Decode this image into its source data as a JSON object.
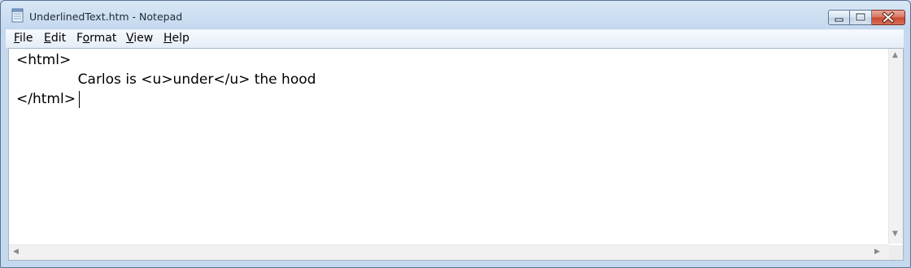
{
  "window": {
    "title": "UnderlinedText.htm - Notepad"
  },
  "menu": [
    {
      "label": "File",
      "accel": "F",
      "rest": "ile"
    },
    {
      "label": "Edit",
      "accel": "E",
      "rest": "dit"
    },
    {
      "label": "Format",
      "pre": "F",
      "accel": "o",
      "rest": "rmat"
    },
    {
      "label": "View",
      "accel": "V",
      "rest": "iew"
    },
    {
      "label": "Help",
      "accel": "H",
      "rest": "elp"
    }
  ],
  "document": {
    "lines": [
      "<html>",
      "\t\tCarlos is <u>under</u> the hood",
      "</html>"
    ],
    "line_display": [
      "<html>",
      "              Carlos is <u>under</u> the hood",
      "</html>"
    ]
  },
  "icons": {
    "app": "notepad-icon",
    "minimize": "minimize-icon",
    "maximize": "maximize-icon",
    "close": "close-icon"
  },
  "colors": {
    "frame": "#c4d8ee",
    "close_button": "#c7472f",
    "editor_bg": "#ffffff"
  }
}
